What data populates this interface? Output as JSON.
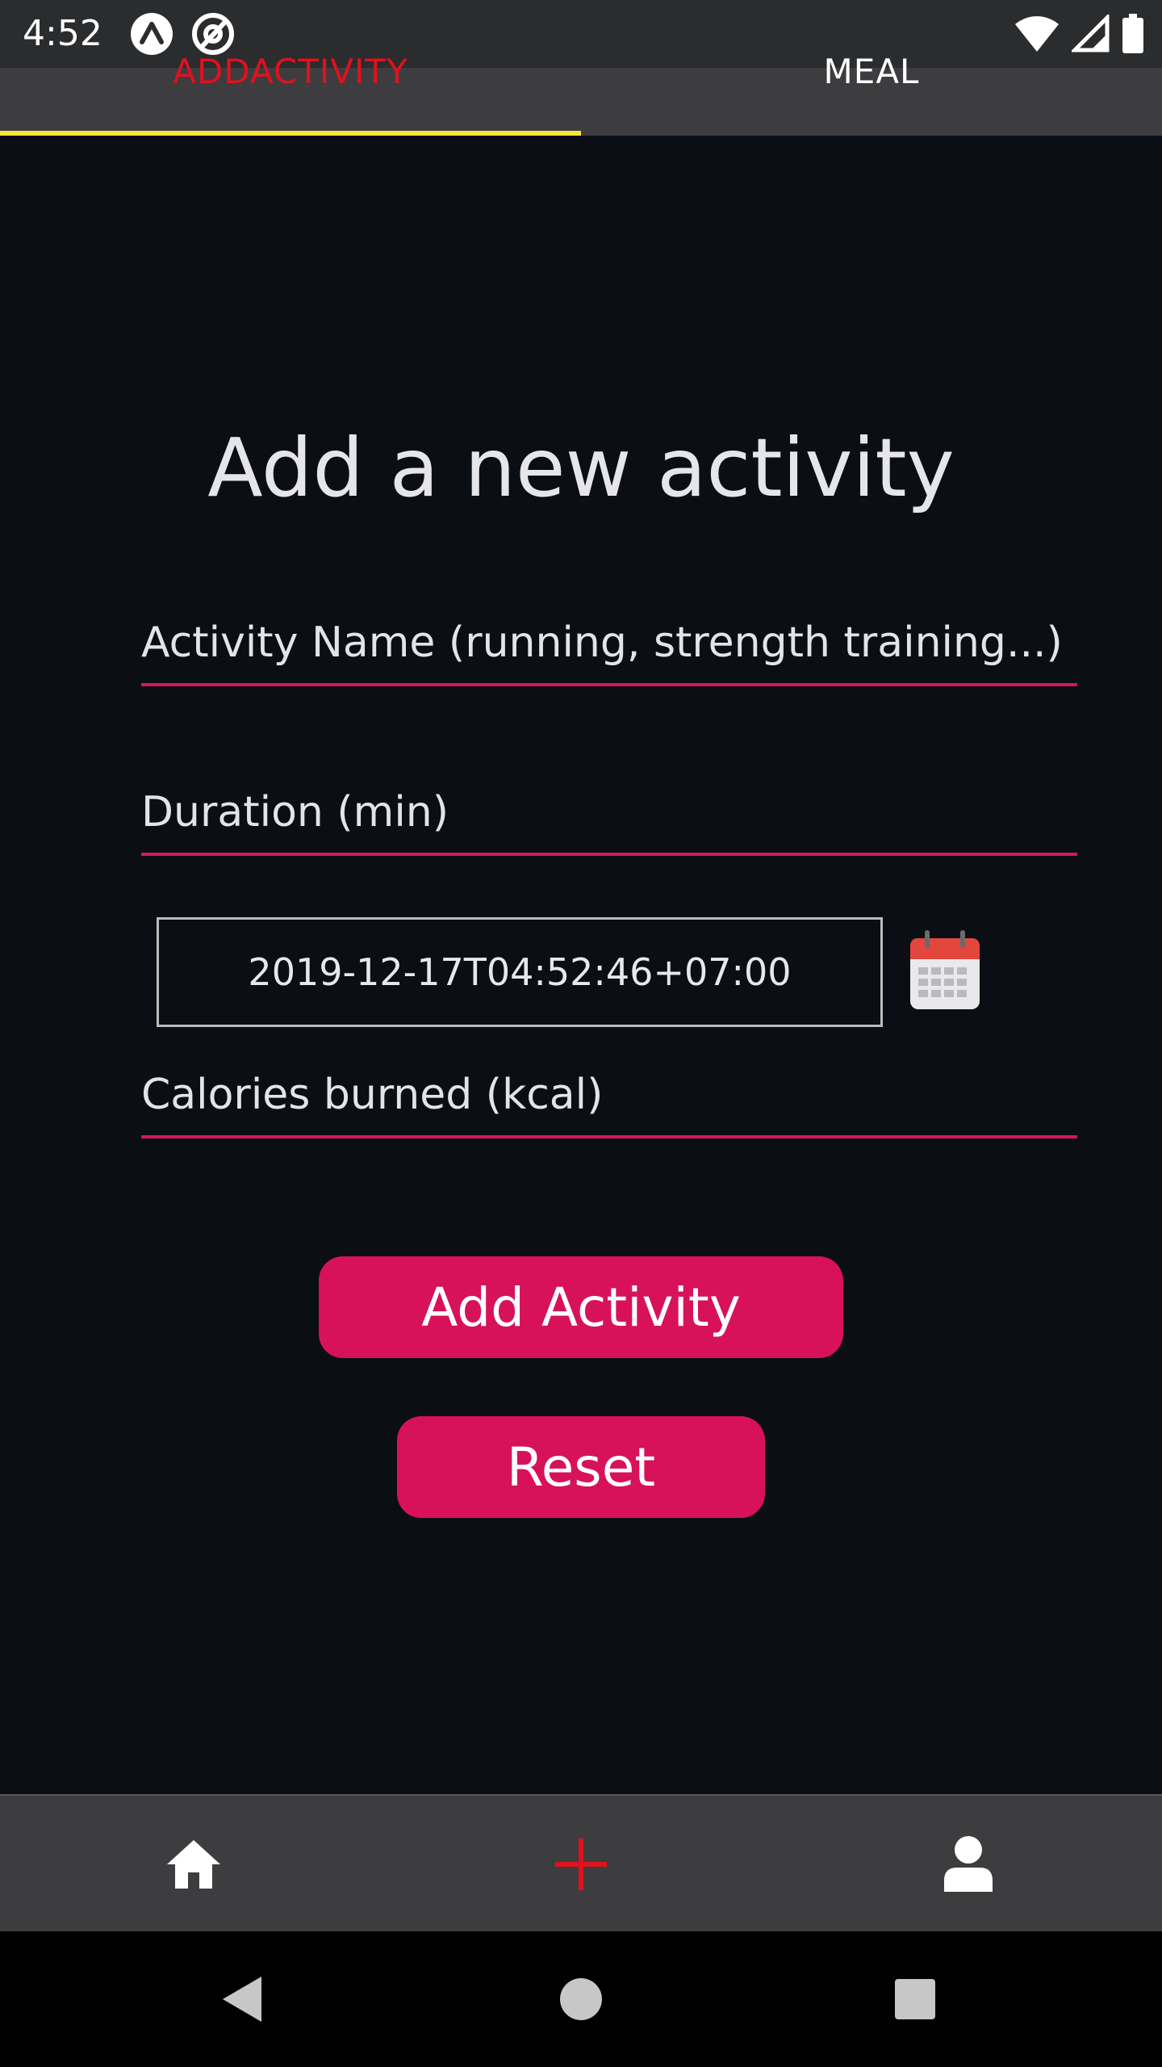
{
  "status_bar": {
    "time": "4:52",
    "icons": [
      "expo-icon",
      "at-sign-icon",
      "wifi-icon",
      "signal-icon",
      "battery-icon"
    ]
  },
  "tabs": [
    {
      "label": "ADDACTIVITY",
      "active": true
    },
    {
      "label": "MEAL",
      "active": false
    }
  ],
  "colors": {
    "background": "#0b0e15",
    "accent": "#d7125b",
    "active_tab_text": "#e0111d",
    "tab_indicator": "#f2e83a"
  },
  "form": {
    "title": "Add a new activity",
    "activity_name_placeholder": "Activity Name (running, strength training...)",
    "duration_placeholder": "Duration (min)",
    "date_value": "2019-12-17T04:52:46+07:00",
    "calories_placeholder": "Calories burned (kcal)",
    "add_button_label": "Add Activity",
    "reset_button_label": "Reset"
  },
  "bottom_nav": {
    "items": [
      "home-icon",
      "plus-icon",
      "user-icon"
    ],
    "active_index": 1
  },
  "system_nav": [
    "back-icon",
    "home-circle-icon",
    "recents-icon"
  ]
}
